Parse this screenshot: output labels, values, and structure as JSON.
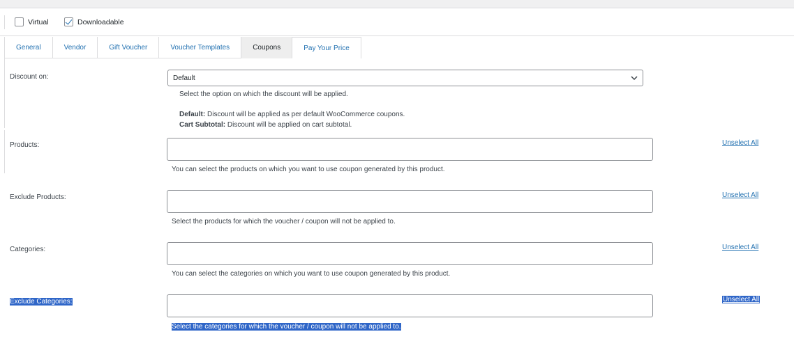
{
  "product_type": {
    "virtual": {
      "label": "Virtual",
      "checked": false
    },
    "downloadable": {
      "label": "Downloadable",
      "checked": true
    }
  },
  "tabs": [
    {
      "label": "General",
      "active": false
    },
    {
      "label": "Vendor",
      "active": false
    },
    {
      "label": "Gift Voucher",
      "active": false
    },
    {
      "label": "Voucher Templates",
      "active": false
    },
    {
      "label": "Coupons",
      "active": true
    },
    {
      "label": "Pay Your Price",
      "active": false
    }
  ],
  "discount_on": {
    "label": "Discount on:",
    "selected": "Default",
    "description": "Select the option on which the discount will be applied.",
    "default_term": "Default:",
    "default_text": "Discount will be applied as per default WooCommerce coupons.",
    "cart_term": "Cart Subtotal:",
    "cart_text": "Discount will be applied on cart subtotal."
  },
  "products": {
    "label": "Products:",
    "description": "You can select the products on which you want to use coupon generated by this product.",
    "unselect_label": "Unselect All"
  },
  "exclude_products": {
    "label": "Exclude Products:",
    "description": "Select the products for which the voucher / coupon will not be applied to.",
    "unselect_label": "Unselect All"
  },
  "categories": {
    "label": "Categories:",
    "description": "You can select the categories on which you want to use coupon generated by this product.",
    "unselect_label": "Unselect All"
  },
  "exclude_categories": {
    "label": "Exclude Categories:",
    "description": "Select the categories for which the voucher / coupon will not be applied to.",
    "unselect_label": "Unselect All"
  },
  "colors": {
    "link": "#2271b1",
    "selection_highlight": "#2f66c8",
    "border": "#8c8f94"
  }
}
